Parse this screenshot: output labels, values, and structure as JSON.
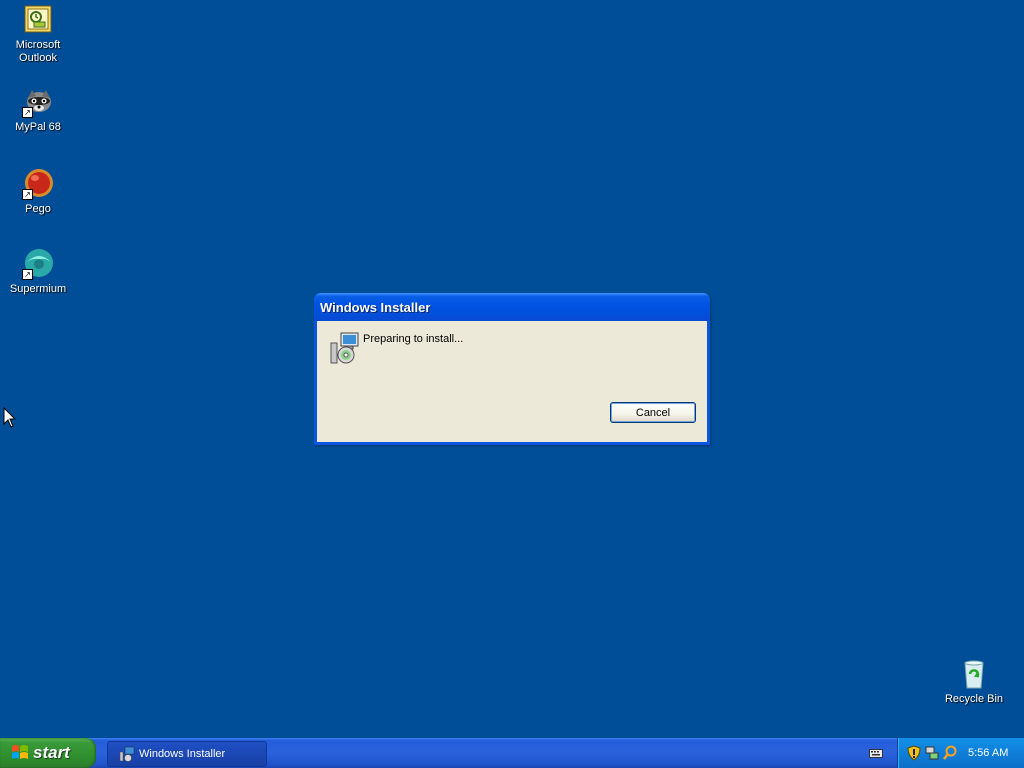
{
  "desktop": {
    "icons": [
      {
        "label": "Microsoft\nOutlook"
      },
      {
        "label": "MyPal 68"
      },
      {
        "label": "Pego"
      },
      {
        "label": "Supermium"
      },
      {
        "label": "Recycle Bin"
      }
    ]
  },
  "dialog": {
    "title": "Windows Installer",
    "message": "Preparing to install...",
    "cancel_label": "Cancel"
  },
  "taskbar": {
    "start_label": "start",
    "tasks": [
      {
        "label": "Windows Installer"
      }
    ],
    "clock": "5:56 AM"
  },
  "colors": {
    "desktop_bg": "#004e98",
    "titlebar": "#0053e3",
    "dialog_body": "#ece9d8",
    "start_green": "#2f8f2f",
    "tray_blue": "#0f7fd8"
  }
}
